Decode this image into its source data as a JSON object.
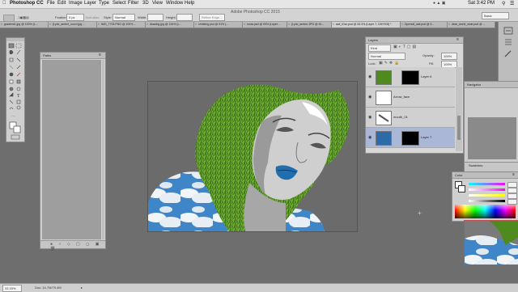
{
  "menubar": {
    "app_name": "Photoshop CC",
    "items": [
      "File",
      "Edit",
      "Image",
      "Layer",
      "Type",
      "Select",
      "Filter",
      "3D",
      "View",
      "Window",
      "Help"
    ],
    "time": "Sat 3:42 PM"
  },
  "options": {
    "app_title": "Adobe Photoshop CC 2015",
    "feather_label": "Feather:",
    "feather_value": "0 px",
    "antialias_label": "Anti-alias",
    "style_label": "Style:",
    "style_value": "Normal",
    "width_label": "Width:",
    "height_label": "Height:",
    "refine_edge": "Refine Edge...",
    "workspace": "Basic"
  },
  "tabs": [
    "gradient1.jpg @ 100% (L...",
    "(Lyric_ambre_nouvl.jpg ...",
    "IMG_7703.PNG @ 100% ...",
    "drawing.jpg @ 134% (L...",
    "christing.psd @ 91% (...",
    "snow.psd @ 93% (Layer...",
    "(Lyric_ambre.JPG @ 61...",
    "awl_lOcc.psd @ 33.3% (Layer 7, CMYK/8) *",
    "Dpresdl_awl.psd @ 3...",
    "dear_world_wide.psd @ ..."
  ],
  "paths_panel": {
    "title": "Paths"
  },
  "layers_panel": {
    "title": "Layers",
    "kind_value": "Kind",
    "blend_value": "Normal",
    "opacity_label": "Opacity:",
    "opacity_value": "100%",
    "lock_label": "Lock:",
    "fill_label": "Fill:",
    "fill_value": "100%",
    "layers": [
      {
        "name": "Layer 6",
        "selected": false
      },
      {
        "name": "Arrow_face",
        "selected": false
      },
      {
        "name": "mouth_01",
        "selected": false
      },
      {
        "name": "Layer 7",
        "selected": true
      }
    ]
  },
  "navigator": {
    "title": "Navigator"
  },
  "swatches": {
    "title": "Swatches"
  },
  "color_panel": {
    "title": "Color"
  },
  "status": {
    "zoom": "33.33%",
    "doc": "Doc: 14.7M/79.4M"
  },
  "colors": {
    "grass": "#4e8a1e",
    "sky": "#3f86c9",
    "selection": "#aab7d7"
  }
}
